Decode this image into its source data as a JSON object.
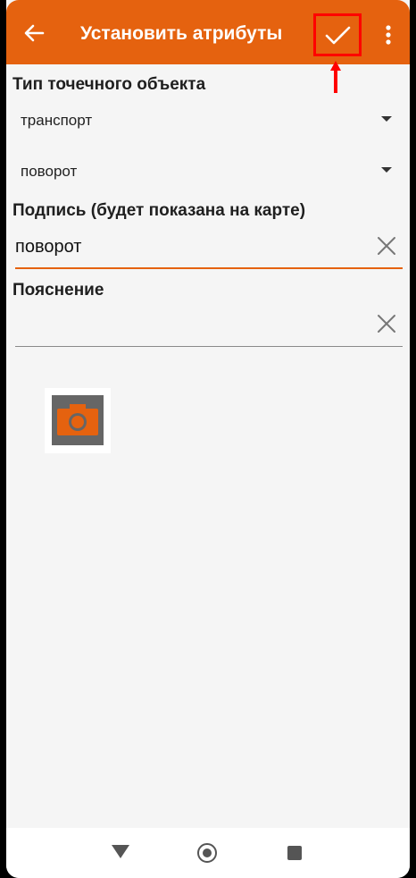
{
  "app_bar": {
    "title": "Установить атрибуты",
    "background_color": "#e5620f",
    "back_icon": "arrow-left-icon",
    "confirm_icon": "check-icon",
    "more_icon": "more-vertical-icon"
  },
  "annotation": {
    "highlight_color": "#ff0000",
    "target": "confirm-button",
    "arrow_icon": "arrow-up-icon"
  },
  "form": {
    "object_type_label": "Тип точечного объекта",
    "category_select": {
      "value": "транспорт"
    },
    "subtype_select": {
      "value": "поворот"
    },
    "caption_label": "Подпись (будет показана на карте)",
    "caption_input": {
      "value": "поворот",
      "placeholder": ""
    },
    "note_label": "Пояснение",
    "note_input": {
      "value": "",
      "placeholder": ""
    }
  },
  "photo": {
    "icon": "camera-icon",
    "accent_color": "#e5620f"
  },
  "system_nav": {
    "back_icon": "triangle-back-icon",
    "home_icon": "circle-home-icon",
    "recents_icon": "square-recents-icon"
  }
}
